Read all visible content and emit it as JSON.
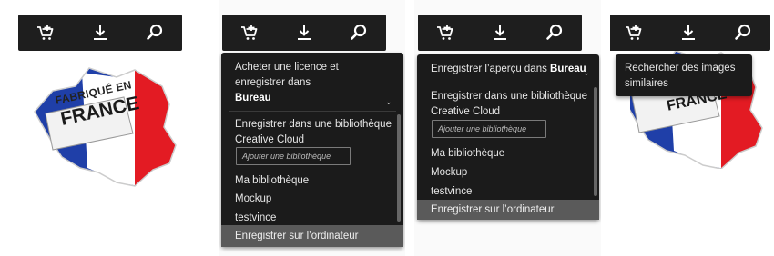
{
  "toolbar": {
    "icons": [
      "add-to-cart-icon",
      "download-icon",
      "search-icon"
    ]
  },
  "badge": {
    "line1": "FABRIQUÉ EN",
    "line2": "FRANCE",
    "colors": {
      "blue": "#1f3fa8",
      "white": "#ffffff",
      "red": "#e31b23"
    }
  },
  "panel2": {
    "header_line1": "Acheter une licence et",
    "header_line2": "enregistrer dans",
    "header_bold": "Bureau",
    "cc_line1": "Enregistrer dans une bibliothèque",
    "cc_line2": "Creative Cloud",
    "input_placeholder": "Ajouter une bibliothèque",
    "lib1": "Ma bibliothèque",
    "lib2": "Mockup",
    "lib3": "testvince",
    "save_computer": "Enregistrer sur l’ordinateur"
  },
  "panel3": {
    "header_prefix": "Enregistrer l’aperçu dans",
    "header_bold": "Bureau",
    "cc_line1": "Enregistrer dans une bibliothèque",
    "cc_line2": "Creative Cloud",
    "input_placeholder": "Ajouter une bibliothèque",
    "lib1": "Ma bibliothèque",
    "lib2": "Mockup",
    "lib3": "testvince",
    "save_computer": "Enregistrer sur l’ordinateur"
  },
  "panel4": {
    "tooltip_line1": "Rechercher des images",
    "tooltip_line2": "similaires"
  },
  "theme": {
    "toolbar_bg": "#1e1e1e",
    "menu_bg": "#1b1b1b",
    "highlight": "#5a5a5a"
  }
}
